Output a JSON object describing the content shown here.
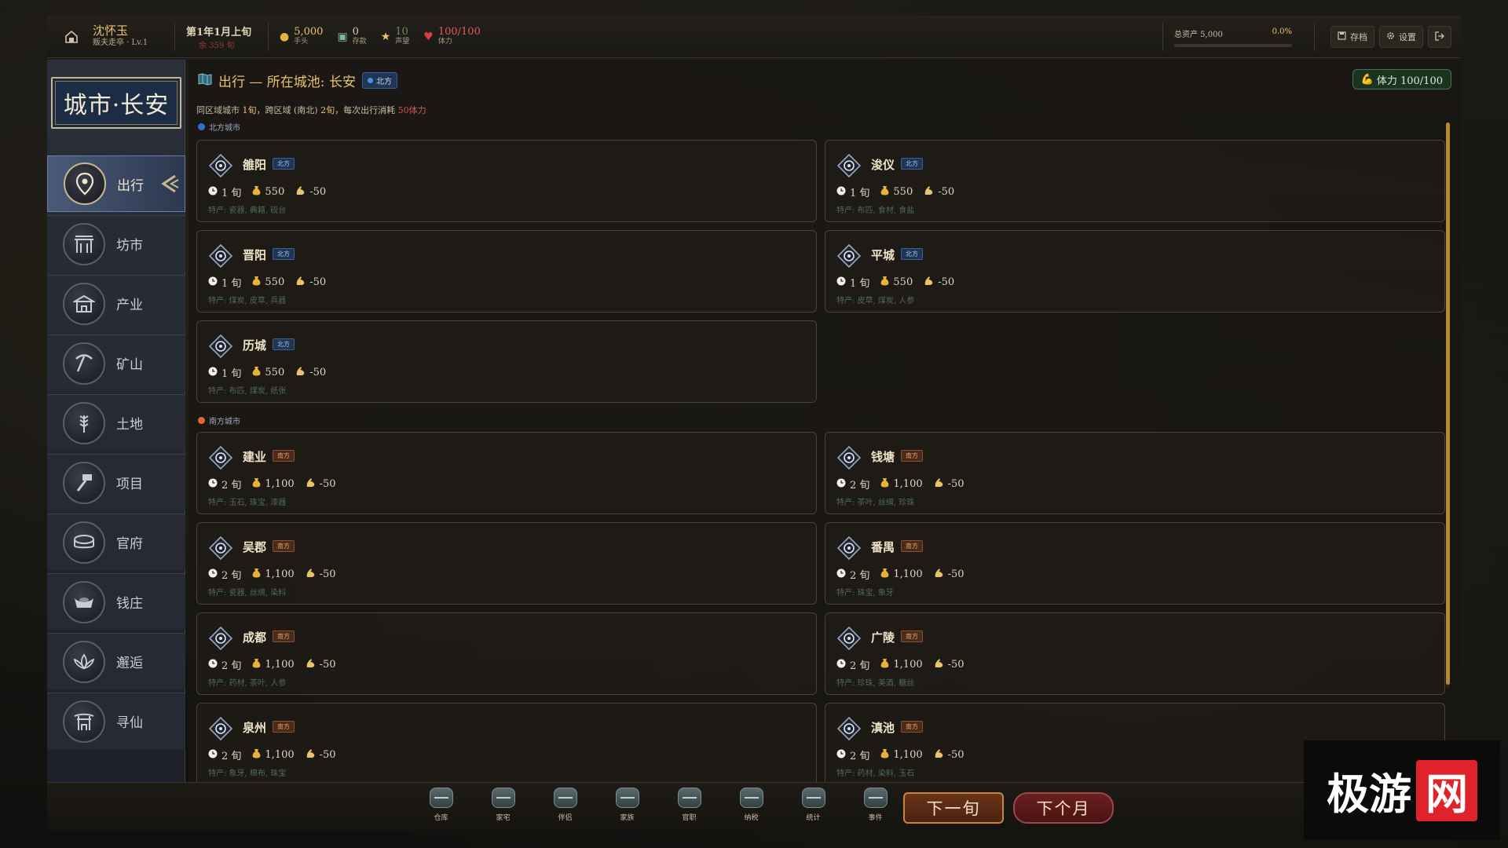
{
  "player": {
    "name": "沈怀玉",
    "rank": "贩夫走卒 · Lv.1"
  },
  "date": {
    "label": "第1年1月上旬",
    "sub": "余 359 旬"
  },
  "stats": [
    {
      "icon": "money-bag-icon",
      "value": "5,000",
      "label": "手头",
      "color": "#e8c36a"
    },
    {
      "icon": "bank-icon",
      "value": "0",
      "label": "存款",
      "color": "#d9cdb4"
    },
    {
      "icon": "star-icon",
      "value": "10",
      "label": "声望",
      "color": "#6a8a5a"
    },
    {
      "icon": "heart-icon",
      "value": "100/100",
      "label": "体力",
      "color": "#e05a5a"
    }
  ],
  "assets": {
    "label": "总资产 5,000",
    "percent": "0.0%",
    "progress": 0.0
  },
  "topbar_buttons": {
    "save": "存档",
    "settings": "设置"
  },
  "sidebar": {
    "city_banner": "城市·长安",
    "items": [
      {
        "id": "travel",
        "label": "出行",
        "icon": "location-pin-icon",
        "active": true
      },
      {
        "id": "market",
        "label": "坊市",
        "icon": "market-gate-icon",
        "active": false
      },
      {
        "id": "industry",
        "label": "产业",
        "icon": "building-icon",
        "active": false
      },
      {
        "id": "mine",
        "label": "矿山",
        "icon": "pickaxe-icon",
        "active": false
      },
      {
        "id": "land",
        "label": "土地",
        "icon": "wheat-icon",
        "active": false
      },
      {
        "id": "project",
        "label": "项目",
        "icon": "hammer-icon",
        "active": false
      },
      {
        "id": "office",
        "label": "官府",
        "icon": "drum-icon",
        "active": false
      },
      {
        "id": "bank",
        "label": "钱庄",
        "icon": "silver-ingot-icon",
        "active": false
      },
      {
        "id": "encounter",
        "label": "邂逅",
        "icon": "lotus-icon",
        "active": false
      },
      {
        "id": "immortal",
        "label": "寻仙",
        "icon": "shrine-icon",
        "active": false
      }
    ]
  },
  "main": {
    "title": "出行 — 所在城池: 长安",
    "region_badge": "北方",
    "stamina": "体力 100/100",
    "info_prefix": "同区域城市 ",
    "info_same": "1旬",
    "info_mid": "，跨区域 (南北) ",
    "info_cross": "2旬",
    "info_suffix": "，每次出行消耗 ",
    "info_cost": "50体力",
    "north_label": "北方城市",
    "south_label": "南方城市",
    "north_cities": [
      {
        "name": "雒阳",
        "tag": "北方",
        "time": "1 旬",
        "cost": "550",
        "stamina": "-50",
        "specialty": "特产: 瓷器, 典籍, 砚台"
      },
      {
        "name": "浚仪",
        "tag": "北方",
        "time": "1 旬",
        "cost": "550",
        "stamina": "-50",
        "specialty": "特产: 布匹, 食材, 食盐"
      },
      {
        "name": "晋阳",
        "tag": "北方",
        "time": "1 旬",
        "cost": "550",
        "stamina": "-50",
        "specialty": "特产: 煤炭, 皮草, 兵器"
      },
      {
        "name": "平城",
        "tag": "北方",
        "time": "1 旬",
        "cost": "550",
        "stamina": "-50",
        "specialty": "特产: 皮草, 煤炭, 人参"
      },
      {
        "name": "历城",
        "tag": "北方",
        "time": "1 旬",
        "cost": "550",
        "stamina": "-50",
        "specialty": "特产: 布匹, 煤炭, 纸张"
      }
    ],
    "south_cities": [
      {
        "name": "建业",
        "tag": "南方",
        "time": "2 旬",
        "cost": "1,100",
        "stamina": "-50",
        "specialty": "特产: 玉石, 珠宝, 漆器"
      },
      {
        "name": "钱塘",
        "tag": "南方",
        "time": "2 旬",
        "cost": "1,100",
        "stamina": "-50",
        "specialty": "特产: 茶叶, 丝绸, 珍珠"
      },
      {
        "name": "吴郡",
        "tag": "南方",
        "time": "2 旬",
        "cost": "1,100",
        "stamina": "-50",
        "specialty": "特产: 瓷器, 丝绸, 染料"
      },
      {
        "name": "番禺",
        "tag": "南方",
        "time": "2 旬",
        "cost": "1,100",
        "stamina": "-50",
        "specialty": "特产: 珠宝, 象牙"
      },
      {
        "name": "成都",
        "tag": "南方",
        "time": "2 旬",
        "cost": "1,100",
        "stamina": "-50",
        "specialty": "特产: 药材, 茶叶, 人参"
      },
      {
        "name": "广陵",
        "tag": "南方",
        "time": "2 旬",
        "cost": "1,100",
        "stamina": "-50",
        "specialty": "特产: 珍珠, 美酒, 糖丝"
      },
      {
        "name": "泉州",
        "tag": "南方",
        "time": "2 旬",
        "cost": "1,100",
        "stamina": "-50",
        "specialty": "特产: 象牙, 棉布, 珠宝"
      },
      {
        "name": "滇池",
        "tag": "南方",
        "time": "2 旬",
        "cost": "1,100",
        "stamina": "-50",
        "specialty": "特产: 药材, 染料, 玉石"
      }
    ]
  },
  "bottombar": {
    "items": [
      "仓库",
      "家宅",
      "伴侣",
      "家族",
      "官职",
      "纳税",
      "统计",
      "事件"
    ],
    "next_xun": "下一旬",
    "next_month": "下个月"
  },
  "watermark": {
    "text": "极游",
    "box": "网"
  }
}
